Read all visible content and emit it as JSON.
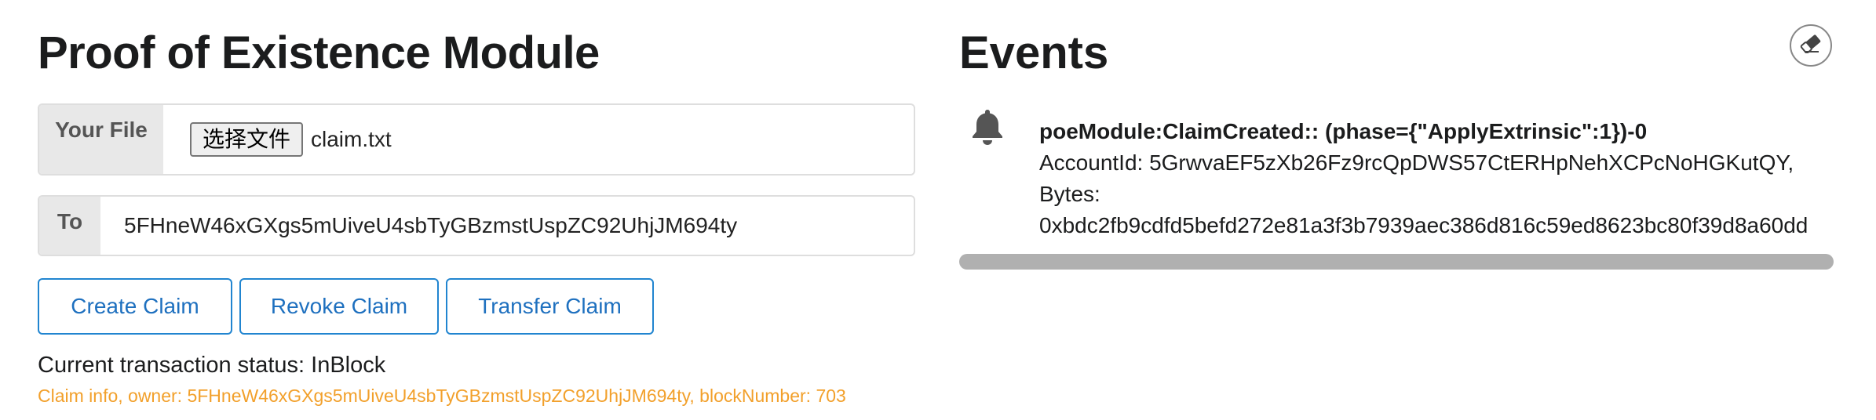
{
  "poe": {
    "title": "Proof of Existence Module",
    "file_label": "Your File",
    "file_button": "选择文件",
    "file_name": "claim.txt",
    "to_label": "To",
    "to_value": "5FHneW46xGXgs5mUiveU4sbTyGBzmstUspZC92UhjJM694ty",
    "buttons": {
      "create": "Create Claim",
      "revoke": "Revoke Claim",
      "transfer": "Transfer Claim"
    },
    "status": "Current transaction status: InBlock",
    "claim_info": "Claim info, owner: 5FHneW46xGXgs5mUiveU4sbTyGBzmstUspZC92UhjJM694ty, blockNumber: 703",
    "claim_info_color": "#f2a02b"
  },
  "events": {
    "title": "Events",
    "clear_icon": "eraser-icon",
    "items": [
      {
        "icon": "bell-icon",
        "header": "poeModule:ClaimCreated:: (phase={\"ApplyExtrinsic\":1})-0",
        "line1": "AccountId: 5GrwvaEF5zXb26Fz9rcQpDWS57CtERHpNehXCPcNoHGKutQY,",
        "line2": "Bytes:",
        "line3": "0xbdc2fb9cdfd5befd272e81a3f3b7939aec386d816c59ed8623bc80f39d8a60dd"
      }
    ]
  },
  "colors": {
    "accent": "#2185d0",
    "button_text": "#1e70bf",
    "label_bg": "#e8e8e8"
  }
}
